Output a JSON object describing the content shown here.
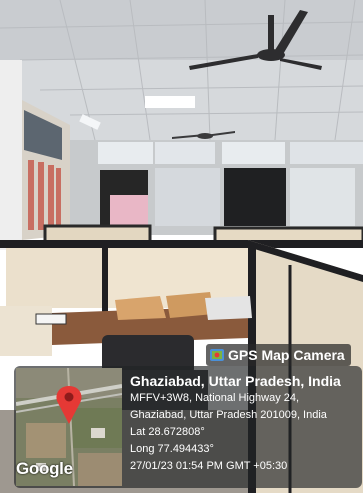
{
  "overlay": {
    "badge_label": "GPS Map Camera",
    "city_line": "Ghaziabad, Uttar Pradesh, India",
    "address_line_1": "MFFV+3W8, National Highway 24,",
    "address_line_2": "Ghaziabad, Uttar Pradesh 201009, India",
    "latitude": "Lat 28.672808°",
    "longitude": "Long 77.494433°",
    "timestamp": "27/01/23 01:54 PM GMT +05:30",
    "map_attribution": "Google"
  },
  "icons": {
    "badge_icon": "map-camera-icon",
    "pin_icon": "location-pin-icon"
  },
  "colors": {
    "pin": "#e53935",
    "overlay_bg": "#222426",
    "wall": "#e8dcc8",
    "partition": "#1f1f22"
  }
}
